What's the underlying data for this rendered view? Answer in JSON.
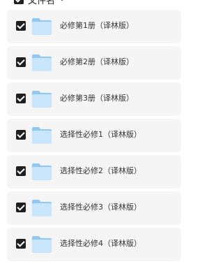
{
  "header": {
    "label": "文件名",
    "checkbox_icon": "checkbox-checked-icon",
    "sort_icon": "chevron-down-icon"
  },
  "colors": {
    "row_background": "#f5f5f6",
    "checkbox": "#1f1f1f",
    "folder_light": "#c9e5fb",
    "folder_dark": "#8ec8f5"
  },
  "items": [
    {
      "name": "必修第1册（译林版）",
      "icon": "folder-icon",
      "checked": true
    },
    {
      "name": "必修第2册（译林版）",
      "icon": "folder-icon",
      "checked": true
    },
    {
      "name": "必修第3册（译林版）",
      "icon": "folder-icon",
      "checked": true
    },
    {
      "name": "选择性必修1（译林版）",
      "icon": "folder-icon",
      "checked": true
    },
    {
      "name": "选择性必修2（译林版）",
      "icon": "folder-icon",
      "checked": true
    },
    {
      "name": "选择性必修3（译林版）",
      "icon": "folder-icon",
      "checked": true
    },
    {
      "name": "选择性必修4（译林版）",
      "icon": "folder-icon",
      "checked": true
    }
  ]
}
